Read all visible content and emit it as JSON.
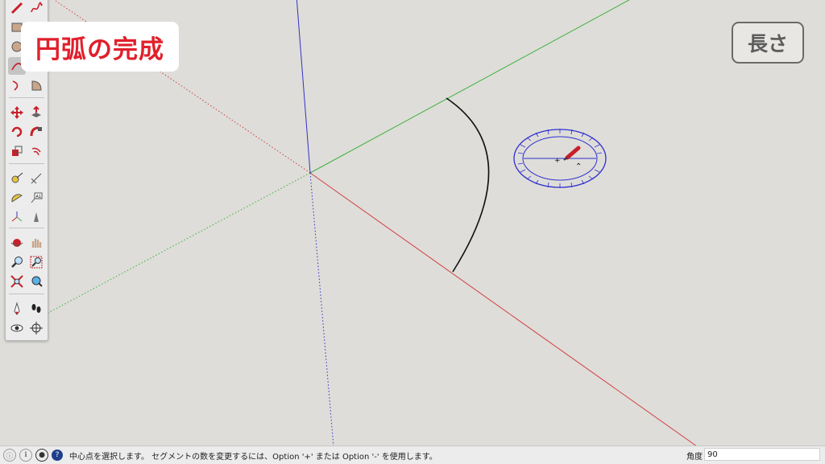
{
  "caption": {
    "text": "円弧の完成"
  },
  "length_badge": {
    "text": "長さ"
  },
  "status_bar": {
    "message": "中心点を選択します。 セグメントの数を変更するには、Option '+' または Option '-' を使用します。",
    "measurement_label": "角度",
    "measurement_value": "90"
  },
  "colors": {
    "canvas": "#deddd9",
    "red_axis": "#d24141",
    "green_axis": "#3fb23f",
    "blue_axis": "#3232c8",
    "protractor": "#3030d0",
    "caption_text": "#e0202c"
  },
  "toolbar": {
    "tools": [
      "pencil-icon",
      "freehand-icon",
      "rectangle-icon",
      "rotated-rectangle-icon",
      "circle-icon",
      "polygon-icon",
      "arc-icon",
      "two-point-arc-icon",
      "three-point-arc-icon",
      "pie-icon",
      "move-icon",
      "push-pull-icon",
      "rotate-icon",
      "follow-me-icon",
      "scale-icon",
      "offset-icon",
      "tape-measure-icon",
      "dimension-icon",
      "protractor-icon",
      "text-icon",
      "axes-icon",
      "3d-text-icon",
      "orbit-icon",
      "pan-icon",
      "zoom-icon",
      "zoom-window-icon",
      "zoom-extents-icon",
      "previous-view-icon",
      "position-camera-icon",
      "walk-icon",
      "look-around-icon",
      "section-plane-icon"
    ]
  }
}
